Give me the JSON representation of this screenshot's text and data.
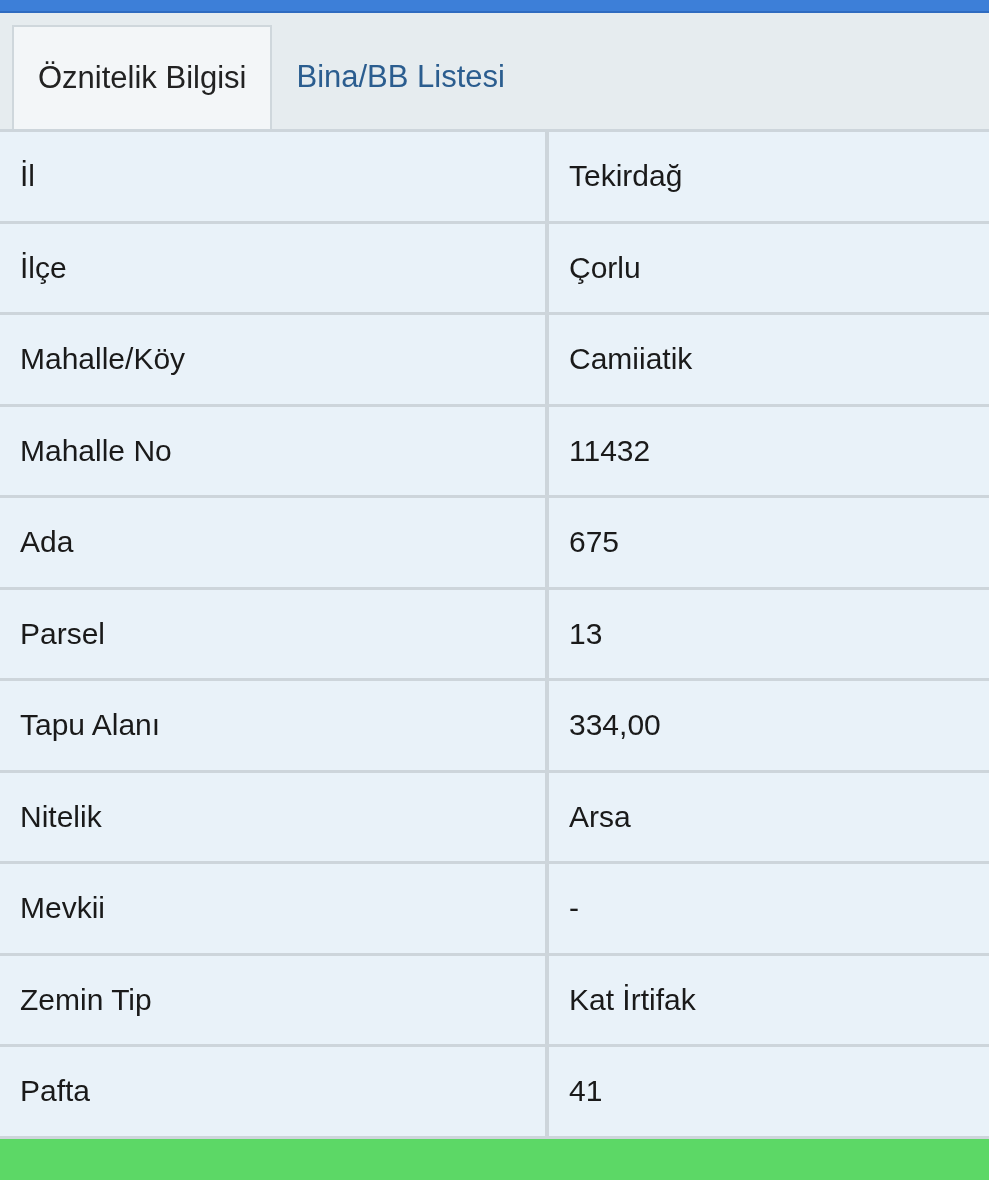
{
  "tabs": [
    {
      "label": "Öznitelik Bilgisi",
      "selected": true
    },
    {
      "label": "Bina/BB Listesi",
      "selected": false
    }
  ],
  "table": {
    "rows": [
      {
        "label": "İl",
        "value": "Tekirdağ"
      },
      {
        "label": "İlçe",
        "value": "Çorlu"
      },
      {
        "label": "Mahalle/Köy",
        "value": "Camiiatik"
      },
      {
        "label": "Mahalle No",
        "value": "11432"
      },
      {
        "label": "Ada",
        "value": "675"
      },
      {
        "label": "Parsel",
        "value": "13"
      },
      {
        "label": "Tapu Alanı",
        "value": "334,00"
      },
      {
        "label": "Nitelik",
        "value": "Arsa"
      },
      {
        "label": "Mevkii",
        "value": "-"
      },
      {
        "label": "Zemin Tip",
        "value": "Kat İrtifak"
      },
      {
        "label": "Pafta",
        "value": "41"
      }
    ]
  }
}
